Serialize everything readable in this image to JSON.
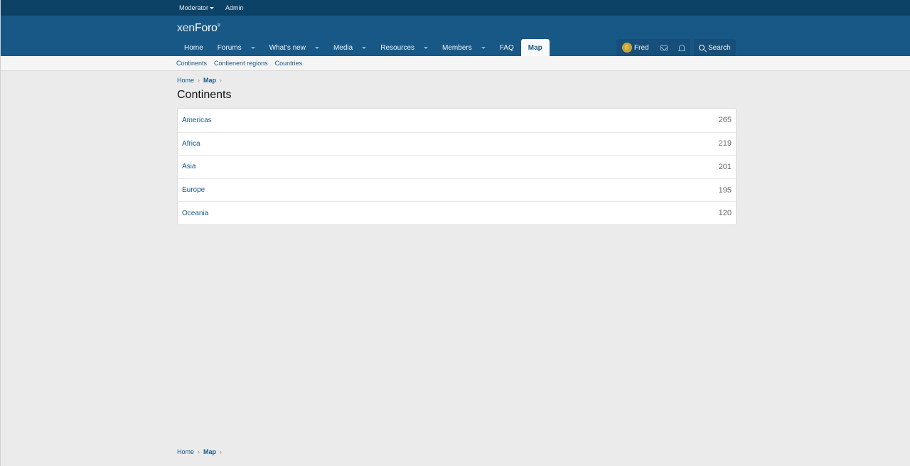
{
  "staff_bar": {
    "moderator": "Moderator",
    "admin": "Admin"
  },
  "header": {
    "logo_light": "xen",
    "logo_bold": "Foro",
    "logo_mark": "®"
  },
  "nav": {
    "tabs": [
      {
        "label": "Home",
        "has_menu": false
      },
      {
        "label": "Forums",
        "has_menu": true
      },
      {
        "label": "What's new",
        "has_menu": true
      },
      {
        "label": "Media",
        "has_menu": true
      },
      {
        "label": "Resources",
        "has_menu": true
      },
      {
        "label": "Members",
        "has_menu": true
      },
      {
        "label": "FAQ",
        "has_menu": false
      },
      {
        "label": "Map",
        "has_menu": false,
        "selected": true
      }
    ]
  },
  "user_nav": {
    "avatar_letter": "F",
    "username": "Fred",
    "search_label": "Search"
  },
  "sub_nav": {
    "links": [
      "Continents",
      "Contienent regions",
      "Countries"
    ]
  },
  "breadcrumb": {
    "home": "Home",
    "current": "Map"
  },
  "page": {
    "title": "Continents"
  },
  "continents": [
    {
      "name": "Americas",
      "count": "265"
    },
    {
      "name": "Africa",
      "count": "219"
    },
    {
      "name": "Asia",
      "count": "201"
    },
    {
      "name": "Europe",
      "count": "195"
    },
    {
      "name": "Oceania",
      "count": "120"
    }
  ],
  "colors": {
    "staff_bar": "#0c4266",
    "header": "#185886",
    "link": "#185886",
    "page_bg": "#ebebeb"
  }
}
